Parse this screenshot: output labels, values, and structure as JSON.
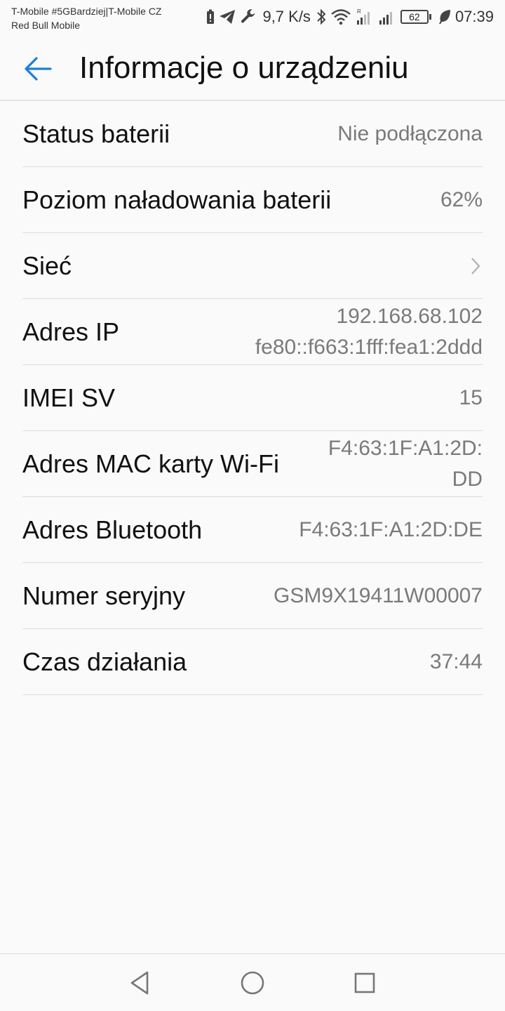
{
  "status_bar": {
    "carrier_line1": "T-Mobile #5GBardziej|T-Mobile CZ",
    "carrier_line2": "Red Bull Mobile",
    "network_speed": "9,7 K/s",
    "battery_level": "62",
    "time": "07:39",
    "icons": [
      "battery-saver-icon",
      "telegram-icon",
      "wrench-icon",
      "bluetooth-icon",
      "wifi-icon",
      "signal-roaming-icon",
      "signal-icon",
      "leaf-icon"
    ]
  },
  "header": {
    "title": "Informacje o urządzeniu",
    "back_icon": "arrow-left-icon",
    "accent_color": "#1a7fe0"
  },
  "rows": [
    {
      "label": "Status baterii",
      "value": "Nie podłączona"
    },
    {
      "label": "Poziom naładowania baterii",
      "value": "62%"
    },
    {
      "label": "Sieć",
      "icon": "chevron-right-icon"
    },
    {
      "label": "Adres IP",
      "value_lines": [
        "192.168.68.102",
        "fe80::f663:1fff:fea1:2ddd"
      ]
    },
    {
      "label": "IMEI SV",
      "value": "15"
    },
    {
      "label": "Adres MAC karty Wi-Fi",
      "value_lines": [
        "F4:63:1F:A1:2D:",
        "DD"
      ]
    },
    {
      "label": "Adres Bluetooth",
      "value": "F4:63:1F:A1:2D:DE"
    },
    {
      "label": "Numer seryjny",
      "value": "GSM9X19411W00007"
    },
    {
      "label": "Czas działania",
      "value": "37:44"
    }
  ],
  "nav_bar": {
    "icons": [
      "nav-back-icon",
      "nav-home-icon",
      "nav-recent-icon"
    ]
  }
}
